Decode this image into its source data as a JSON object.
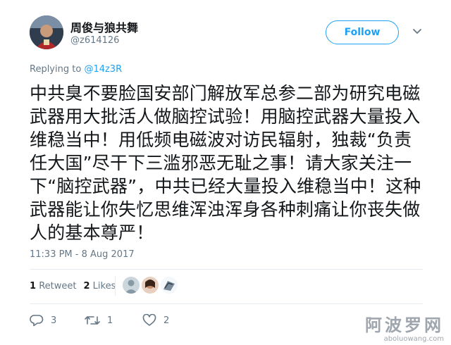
{
  "author": {
    "display_name": "周俊与狼共舞",
    "handle": "@z614126"
  },
  "follow_label": "Follow",
  "reply_context": {
    "prefix": "Replying to",
    "target": "@14z3R"
  },
  "tweet": {
    "text": "中共臭不要脸国安部门解放军总参二部为研究电磁武器用大批活人做脑控试验！用脑控武器大量投入维稳当中！用低频电磁波对访民辐射，独裁“负责任大国”尽干下三滥邪恶无耻之事！请大家关注一下“脑控武器”，中共已经大量投入维稳当中！这种武器能让你失忆思维浑浊浑身各种刺痛让你丧失做人的基本尊严！",
    "timestamp": "11:33 PM - 8 Aug 2017"
  },
  "stats": {
    "retweets_count": "1",
    "retweets_label": "Retweet",
    "likes_count": "2",
    "likes_label": "Likes"
  },
  "actions": {
    "replies": "3",
    "retweets": "1",
    "likes": "2"
  },
  "watermark": {
    "line1": "阿波罗网",
    "line2": "aboluowang.com"
  },
  "colors": {
    "accent": "#1da1f2",
    "muted": "#657786",
    "text": "#14171a"
  }
}
